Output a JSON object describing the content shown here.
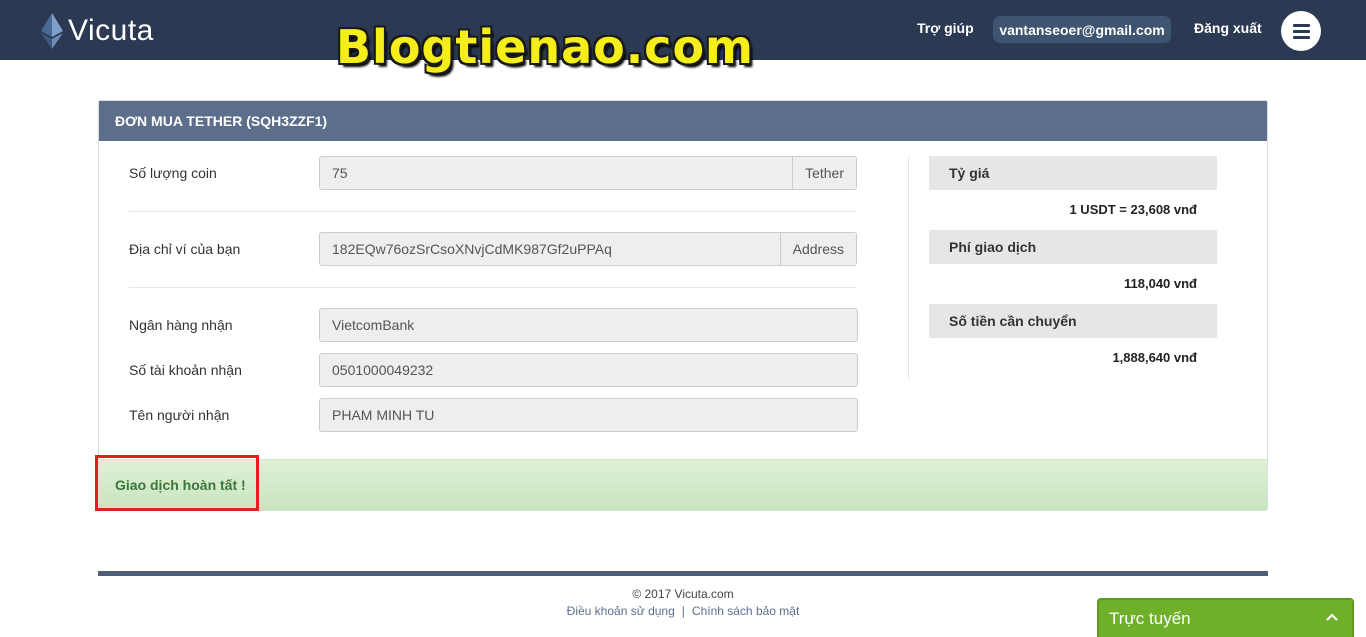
{
  "brand": {
    "name": "Vicuta"
  },
  "watermark": "Blogtienao.com",
  "nav": {
    "help": "Trợ giúp",
    "email": "vantanseoer@gmail.com",
    "logout": "Đăng xuất"
  },
  "order": {
    "title": "ĐƠN MUA TETHER (SQH3ZZF1)",
    "fields": {
      "amount": {
        "label": "Số lượng coin",
        "value": "75",
        "unit": "Tether"
      },
      "wallet": {
        "label": "Địa chỉ ví của bạn",
        "value": "182EQw76ozSrCsoXNvjCdMK987Gf2uPPAq",
        "unit": "Address"
      },
      "bank": {
        "label": "Ngân hàng nhận",
        "value": "VietcomBank"
      },
      "account": {
        "label": "Số tài khoản nhận",
        "value": "0501000049232"
      },
      "receiver": {
        "label": "Tên người nhận",
        "value": "PHAM MINH TU"
      }
    },
    "summary": {
      "rate": {
        "label": "Tỷ giá",
        "value": "1 USDT = 23,608 vnđ"
      },
      "fee": {
        "label": "Phí giao dịch",
        "value": "118,040 vnđ"
      },
      "total": {
        "label": "Số tiền cần chuyển",
        "value": "1,888,640 vnđ"
      }
    },
    "status": "Giao dịch hoàn tất !"
  },
  "footer": {
    "copyright": "© 2017 Vicuta.com",
    "terms": "Điều khoản sử dụng",
    "separator": "|",
    "privacy": "Chính sách bảo mật"
  },
  "chat": {
    "label": "Trực tuyến"
  },
  "colors": {
    "navbar": "#2b3a52",
    "panel_header": "#5c6e8a",
    "success_text": "#3c763d",
    "highlight_box": "#e02020",
    "chat": "#6fb02a",
    "watermark": "#f5ee1a"
  }
}
